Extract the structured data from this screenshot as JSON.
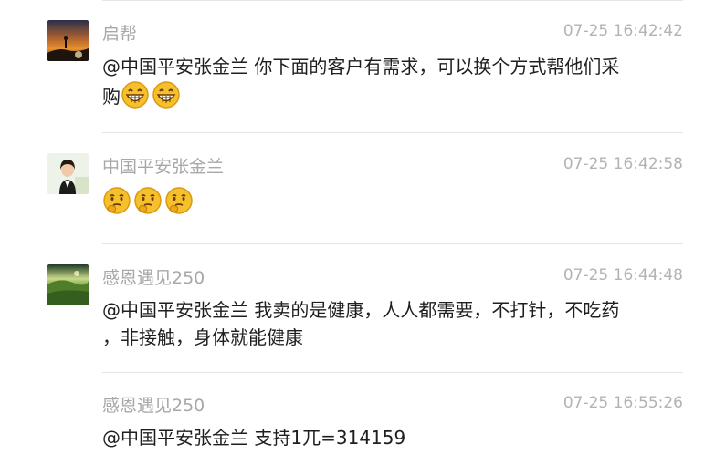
{
  "messages": [
    {
      "name": "启帮",
      "time": "07-25 16:42:42",
      "line1": "@中国平安张金兰 你下面的客户有需求，可以换个方式帮他们采",
      "line2": "购",
      "emojis": [
        "grin-emoji",
        "grin-emoji"
      ]
    },
    {
      "name": "中国平安张金兰",
      "time": "07-25 16:42:58",
      "emojis": [
        "thinking-emoji",
        "thinking-emoji",
        "thinking-emoji"
      ]
    },
    {
      "name": "感恩遇见250",
      "time": "07-25 16:44:48",
      "line1": "@中国平安张金兰 我卖的是健康，人人都需要，不打针，不吃药",
      "line2": "，非接触，身体就能健康"
    },
    {
      "name": "感恩遇见250",
      "time": "07-25 16:55:26",
      "line1": "@中国平安张金兰 支持1兀=314159"
    }
  ]
}
